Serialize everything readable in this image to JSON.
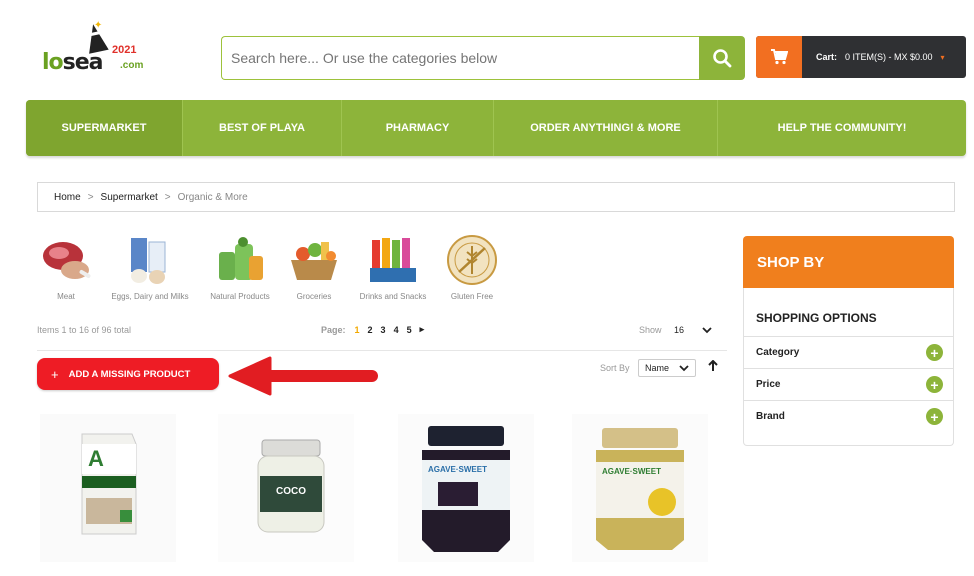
{
  "header": {
    "logo": {
      "text_lo": "lo",
      "text_sea": "sea",
      "text_com": ".com",
      "year": "2021",
      "icon": "party-hat-logo-icon"
    },
    "search": {
      "placeholder": "Search here... Or use the categories below",
      "icon": "search-icon"
    },
    "cart": {
      "label": "Cart:",
      "summary": "0 ITEM(S) - MX $0.00",
      "icon": "cart-icon",
      "caret": "▾"
    }
  },
  "nav": {
    "items": [
      {
        "label": "SUPERMARKET"
      },
      {
        "label": "BEST OF PLAYA"
      },
      {
        "label": "PHARMACY"
      },
      {
        "label": "ORDER ANYTHING! & MORE"
      },
      {
        "label": "HELP THE COMMUNITY!"
      }
    ]
  },
  "breadcrumb": {
    "items": [
      "Home",
      "Supermarket"
    ],
    "current": "Organic & More",
    "separator": ">"
  },
  "categories": [
    {
      "label": "Meat"
    },
    {
      "label": "Eggs, Dairy and Milks"
    },
    {
      "label": "Natural Products"
    },
    {
      "label": "Groceries"
    },
    {
      "label": "Drinks and Snacks"
    },
    {
      "label": "Gluten Free"
    }
  ],
  "toolbar": {
    "items_count": "Items 1 to 16 of 96 total",
    "page_label": "Page:",
    "pages": [
      "1",
      "2",
      "3",
      "4",
      "5"
    ],
    "current_page": "1",
    "next": "▸",
    "show_label": "Show",
    "show_value": "16",
    "sort_label": "Sort By",
    "sort_value": "Name",
    "sort_dir": "🡑"
  },
  "add_missing": {
    "plus": "+",
    "label": "ADD A MISSING PRODUCT"
  },
  "shopby": {
    "title": "SHOP BY",
    "options_title": "SHOPPING OPTIONS",
    "filters": [
      {
        "label": "Category"
      },
      {
        "label": "Price"
      },
      {
        "label": "Brand"
      }
    ]
  },
  "colors": {
    "brand_green": "#8db43a",
    "accent_orange": "#f07f1d",
    "cart_dark": "#2f3033",
    "cta_red": "#ee1c25"
  }
}
